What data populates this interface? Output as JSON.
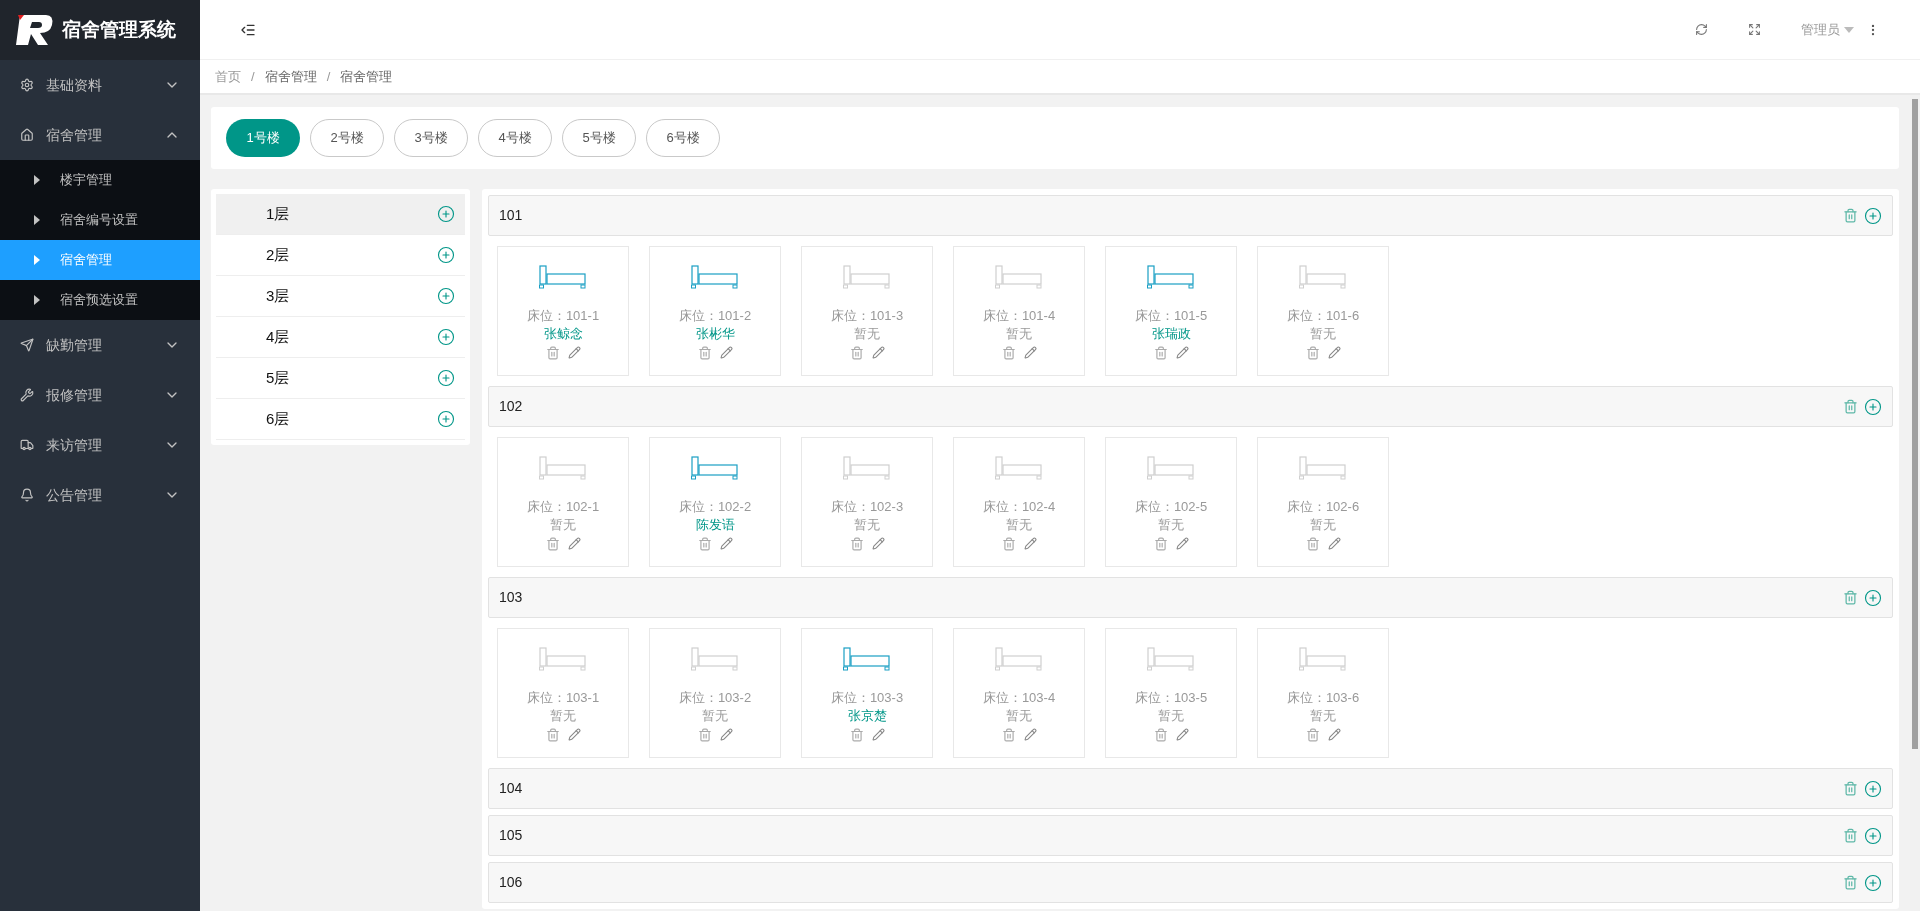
{
  "app": {
    "title": "宿舍管理系统"
  },
  "sidebar": {
    "items": [
      {
        "label": "基础资料",
        "expanded": false
      },
      {
        "label": "宿舍管理",
        "expanded": true,
        "children": [
          {
            "label": "楼宇管理",
            "selected": false
          },
          {
            "label": "宿舍编号设置",
            "selected": false
          },
          {
            "label": "宿舍管理",
            "selected": true
          },
          {
            "label": "宿舍预选设置",
            "selected": false
          }
        ]
      },
      {
        "label": "缺勤管理",
        "expanded": false
      },
      {
        "label": "报修管理",
        "expanded": false
      },
      {
        "label": "来访管理",
        "expanded": false
      },
      {
        "label": "公告管理",
        "expanded": false
      }
    ]
  },
  "header": {
    "user": "管理员"
  },
  "breadcrumb": {
    "items": [
      "首页",
      "宿舍管理",
      "宿舍管理"
    ],
    "separators": [
      "/",
      "/"
    ]
  },
  "buildings": [
    {
      "label": "1号楼",
      "selected": true
    },
    {
      "label": "2号楼",
      "selected": false
    },
    {
      "label": "3号楼",
      "selected": false
    },
    {
      "label": "4号楼",
      "selected": false
    },
    {
      "label": "5号楼",
      "selected": false
    },
    {
      "label": "6号楼",
      "selected": false
    }
  ],
  "floors": [
    {
      "label": "1层",
      "selected": true
    },
    {
      "label": "2层",
      "selected": false
    },
    {
      "label": "3层",
      "selected": false
    },
    {
      "label": "4层",
      "selected": false
    },
    {
      "label": "5层",
      "selected": false
    },
    {
      "label": "6层",
      "selected": false
    }
  ],
  "rooms": [
    {
      "number": "101",
      "beds": [
        {
          "label": "床位：101-1",
          "occupant": "张鲸念",
          "occupied": true
        },
        {
          "label": "床位：101-2",
          "occupant": "张彬华",
          "occupied": true
        },
        {
          "label": "床位：101-3",
          "occupant": "暂无",
          "occupied": false
        },
        {
          "label": "床位：101-4",
          "occupant": "暂无",
          "occupied": false
        },
        {
          "label": "床位：101-5",
          "occupant": "张瑞政",
          "occupied": true
        },
        {
          "label": "床位：101-6",
          "occupant": "暂无",
          "occupied": false
        }
      ]
    },
    {
      "number": "102",
      "beds": [
        {
          "label": "床位：102-1",
          "occupant": "暂无",
          "occupied": false
        },
        {
          "label": "床位：102-2",
          "occupant": "陈发语",
          "occupied": true
        },
        {
          "label": "床位：102-3",
          "occupant": "暂无",
          "occupied": false
        },
        {
          "label": "床位：102-4",
          "occupant": "暂无",
          "occupied": false
        },
        {
          "label": "床位：102-5",
          "occupant": "暂无",
          "occupied": false
        },
        {
          "label": "床位：102-6",
          "occupant": "暂无",
          "occupied": false
        }
      ]
    },
    {
      "number": "103",
      "beds": [
        {
          "label": "床位：103-1",
          "occupant": "暂无",
          "occupied": false
        },
        {
          "label": "床位：103-2",
          "occupant": "暂无",
          "occupied": false
        },
        {
          "label": "床位：103-3",
          "occupant": "张京楚",
          "occupied": true
        },
        {
          "label": "床位：103-4",
          "occupant": "暂无",
          "occupied": false
        },
        {
          "label": "床位：103-5",
          "occupant": "暂无",
          "occupied": false
        },
        {
          "label": "床位：103-6",
          "occupant": "暂无",
          "occupied": false
        }
      ]
    },
    {
      "number": "104"
    },
    {
      "number": "105"
    },
    {
      "number": "106"
    }
  ]
}
